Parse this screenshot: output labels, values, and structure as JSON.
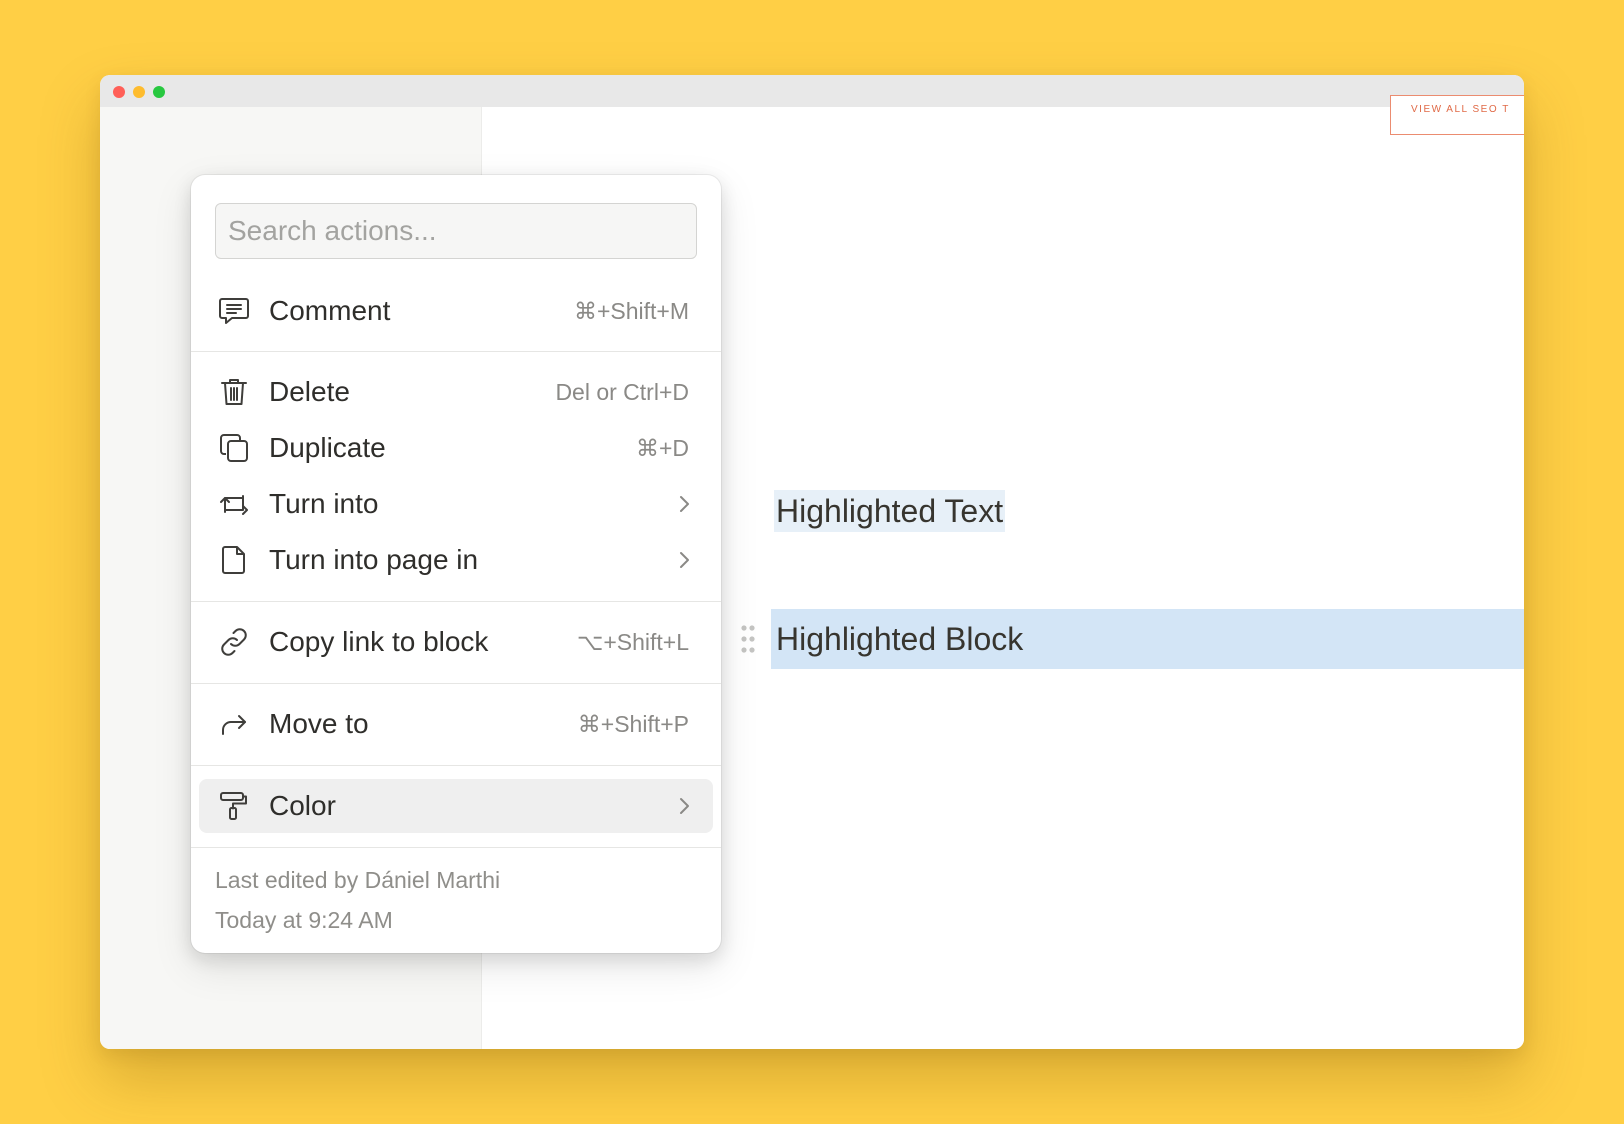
{
  "window": {
    "controls": [
      "close",
      "minimize",
      "zoom"
    ],
    "top_button_label": "VIEW ALL SEO T"
  },
  "document": {
    "highlighted_text": "Highlighted Text",
    "highlighted_block": "Highlighted Block"
  },
  "menu": {
    "search_placeholder": "Search actions...",
    "items": [
      {
        "label": "Comment",
        "shortcut": "⌘+Shift+M",
        "icon": "comment-icon"
      },
      {
        "label": "Delete",
        "shortcut": "Del or Ctrl+D",
        "icon": "trash-icon"
      },
      {
        "label": "Duplicate",
        "shortcut": "⌘+D",
        "icon": "duplicate-icon"
      },
      {
        "label": "Turn into",
        "shortcut": "",
        "icon": "turn-into-icon",
        "submenu": true
      },
      {
        "label": "Turn into page in",
        "shortcut": "",
        "icon": "page-icon",
        "submenu": true
      },
      {
        "label": "Copy link to block",
        "shortcut": "⌥+Shift+L",
        "icon": "link-icon"
      },
      {
        "label": "Move to",
        "shortcut": "⌘+Shift+P",
        "icon": "move-arrow-icon"
      },
      {
        "label": "Color",
        "shortcut": "",
        "icon": "paint-roller-icon",
        "submenu": true,
        "active": true
      }
    ],
    "footer": {
      "edited_by": "Last edited by Dániel Marthi",
      "edited_at": "Today at 9:24 AM"
    }
  },
  "colors": {
    "background": "#FFCF45",
    "highlight_text_bg": "#E7F0F8",
    "highlight_block_bg": "#D3E5F6",
    "active_item_bg": "#EFEFEF"
  }
}
